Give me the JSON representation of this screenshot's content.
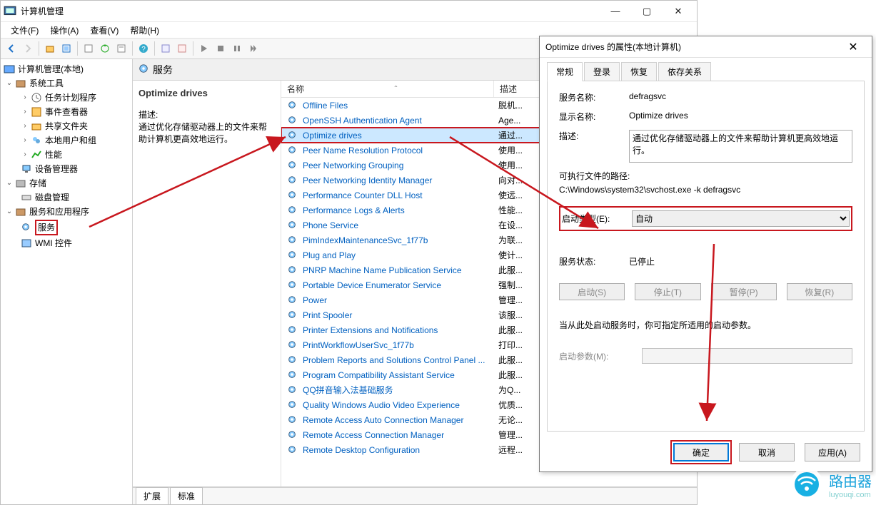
{
  "window": {
    "title": "计算机管理"
  },
  "menu": {
    "file": "文件(F)",
    "action": "操作(A)",
    "view": "查看(V)",
    "help": "帮助(H)"
  },
  "tree": {
    "root": "计算机管理(本地)",
    "systools": "系统工具",
    "task": "任务计划程序",
    "event": "事件查看器",
    "shared": "共享文件夹",
    "users": "本地用户和组",
    "perf": "性能",
    "devmgr": "设备管理器",
    "storage": "存储",
    "diskmgr": "磁盘管理",
    "svcapps": "服务和应用程序",
    "services": "服务",
    "wmi": "WMI 控件"
  },
  "panel": {
    "title": "服务"
  },
  "detail": {
    "name": "Optimize drives",
    "desc_label": "描述:",
    "desc_text": "通过优化存储驱动器上的文件来帮助计算机更高效地运行。"
  },
  "columns": {
    "name": "名称",
    "desc": "描述"
  },
  "services": [
    {
      "name": "Offline Files",
      "desc": "脱机..."
    },
    {
      "name": "OpenSSH Authentication Agent",
      "desc": "Age..."
    },
    {
      "name": "Optimize drives",
      "desc": "通过...",
      "selected": true
    },
    {
      "name": "Peer Name Resolution Protocol",
      "desc": "使用..."
    },
    {
      "name": "Peer Networking Grouping",
      "desc": "使用..."
    },
    {
      "name": "Peer Networking Identity Manager",
      "desc": "向对..."
    },
    {
      "name": "Performance Counter DLL Host",
      "desc": "使远..."
    },
    {
      "name": "Performance Logs & Alerts",
      "desc": "性能..."
    },
    {
      "name": "Phone Service",
      "desc": "在设..."
    },
    {
      "name": "PimIndexMaintenanceSvc_1f77b",
      "desc": "为联..."
    },
    {
      "name": "Plug and Play",
      "desc": "使计..."
    },
    {
      "name": "PNRP Machine Name Publication Service",
      "desc": "此服..."
    },
    {
      "name": "Portable Device Enumerator Service",
      "desc": "强制..."
    },
    {
      "name": "Power",
      "desc": "管理..."
    },
    {
      "name": "Print Spooler",
      "desc": "该服..."
    },
    {
      "name": "Printer Extensions and Notifications",
      "desc": "此服..."
    },
    {
      "name": "PrintWorkflowUserSvc_1f77b",
      "desc": "打印..."
    },
    {
      "name": "Problem Reports and Solutions Control Panel ...",
      "desc": "此服..."
    },
    {
      "name": "Program Compatibility Assistant Service",
      "desc": "此服..."
    },
    {
      "name": "QQ拼音输入法基础服务",
      "desc": "为Q..."
    },
    {
      "name": "Quality Windows Audio Video Experience",
      "desc": "优质..."
    },
    {
      "name": "Remote Access Auto Connection Manager",
      "desc": "无论..."
    },
    {
      "name": "Remote Access Connection Manager",
      "desc": "管理..."
    },
    {
      "name": "Remote Desktop Configuration",
      "desc": "远程..."
    }
  ],
  "tabs": {
    "extended": "扩展",
    "standard": "标准"
  },
  "dialog": {
    "title": "Optimize drives 的属性(本地计算机)",
    "tab_general": "常规",
    "tab_logon": "登录",
    "tab_recovery": "恢复",
    "tab_deps": "依存关系",
    "svc_name_label": "服务名称:",
    "svc_name": "defragsvc",
    "disp_name_label": "显示名称:",
    "disp_name": "Optimize drives",
    "desc_label": "描述:",
    "desc": "通过优化存储驱动器上的文件来帮助计算机更高效地运行。",
    "exe_label": "可执行文件的路径:",
    "exe": "C:\\Windows\\system32\\svchost.exe -k defragsvc",
    "startup_label": "启动类型(E):",
    "startup_value": "自动",
    "state_label": "服务状态:",
    "state": "已停止",
    "btn_start": "启动(S)",
    "btn_stop": "停止(T)",
    "btn_pause": "暂停(P)",
    "btn_resume": "恢复(R)",
    "note": "当从此处启动服务时，你可指定所适用的启动参数。",
    "param_label": "启动参数(M):",
    "ok": "确定",
    "cancel": "取消",
    "apply": "应用(A)"
  },
  "watermark": {
    "text": "路由器",
    "sub": "luyouqi.com"
  }
}
